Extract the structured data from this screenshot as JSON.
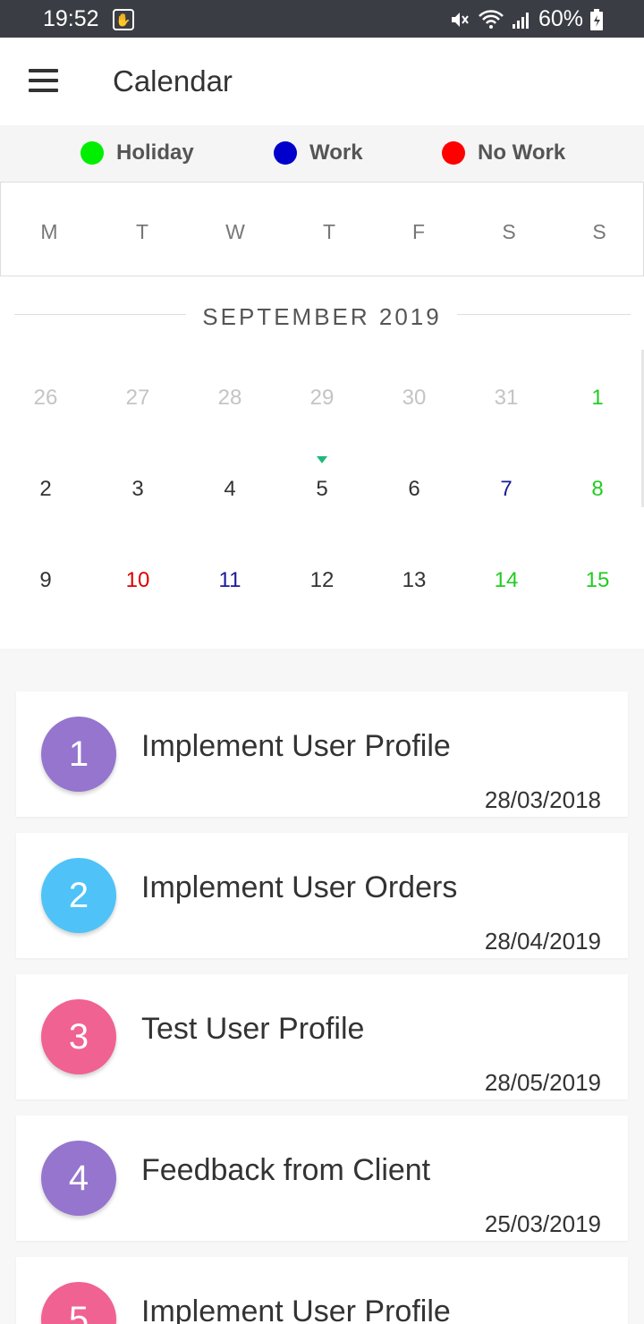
{
  "status_bar": {
    "time": "19:52",
    "battery": "60%",
    "icons": [
      "gesture-icon",
      "mute-icon",
      "wifi-icon",
      "signal-icon",
      "battery-icon"
    ]
  },
  "app_bar": {
    "title": "Calendar",
    "menu_icon": "hamburger-menu-icon"
  },
  "legend": [
    {
      "label": "Holiday",
      "color": "#00ee00"
    },
    {
      "label": "Work",
      "color": "#0000cc"
    },
    {
      "label": "No Work",
      "color": "#ff0000"
    }
  ],
  "weekdays": [
    "M",
    "T",
    "W",
    "T",
    "F",
    "S",
    "S"
  ],
  "month": {
    "title": "SEPTEMBER 2019",
    "weeks": [
      [
        {
          "d": "26",
          "color": "#c4c4c4"
        },
        {
          "d": "27",
          "color": "#c4c4c4"
        },
        {
          "d": "28",
          "color": "#c4c4c4"
        },
        {
          "d": "29",
          "color": "#c4c4c4"
        },
        {
          "d": "30",
          "color": "#c4c4c4"
        },
        {
          "d": "31",
          "color": "#c4c4c4"
        },
        {
          "d": "1",
          "color": "#22cc22"
        }
      ],
      [
        {
          "d": "2",
          "color": "#333333"
        },
        {
          "d": "3",
          "color": "#333333"
        },
        {
          "d": "4",
          "color": "#333333"
        },
        {
          "d": "5",
          "color": "#333333",
          "today": true
        },
        {
          "d": "6",
          "color": "#333333"
        },
        {
          "d": "7",
          "color": "#1a1a99"
        },
        {
          "d": "8",
          "color": "#22cc22"
        }
      ],
      [
        {
          "d": "9",
          "color": "#333333"
        },
        {
          "d": "10",
          "color": "#dd0000"
        },
        {
          "d": "11",
          "color": "#1a1a99"
        },
        {
          "d": "12",
          "color": "#333333"
        },
        {
          "d": "13",
          "color": "#333333"
        },
        {
          "d": "14",
          "color": "#22cc22"
        },
        {
          "d": "15",
          "color": "#22cc22"
        }
      ]
    ]
  },
  "tasks": [
    {
      "num": "1",
      "title": "Implement User Profile",
      "date": "28/03/2018",
      "color": "#9575cd"
    },
    {
      "num": "2",
      "title": "Implement User Orders",
      "date": "28/04/2019",
      "color": "#4fc3f7"
    },
    {
      "num": "3",
      "title": "Test User Profile",
      "date": "28/05/2019",
      "color": "#f06292"
    },
    {
      "num": "4",
      "title": "Feedback from Client",
      "date": "25/03/2019",
      "color": "#9575cd"
    },
    {
      "num": "5",
      "title": "Implement User Profile",
      "date": "",
      "color": "#f06292"
    }
  ]
}
